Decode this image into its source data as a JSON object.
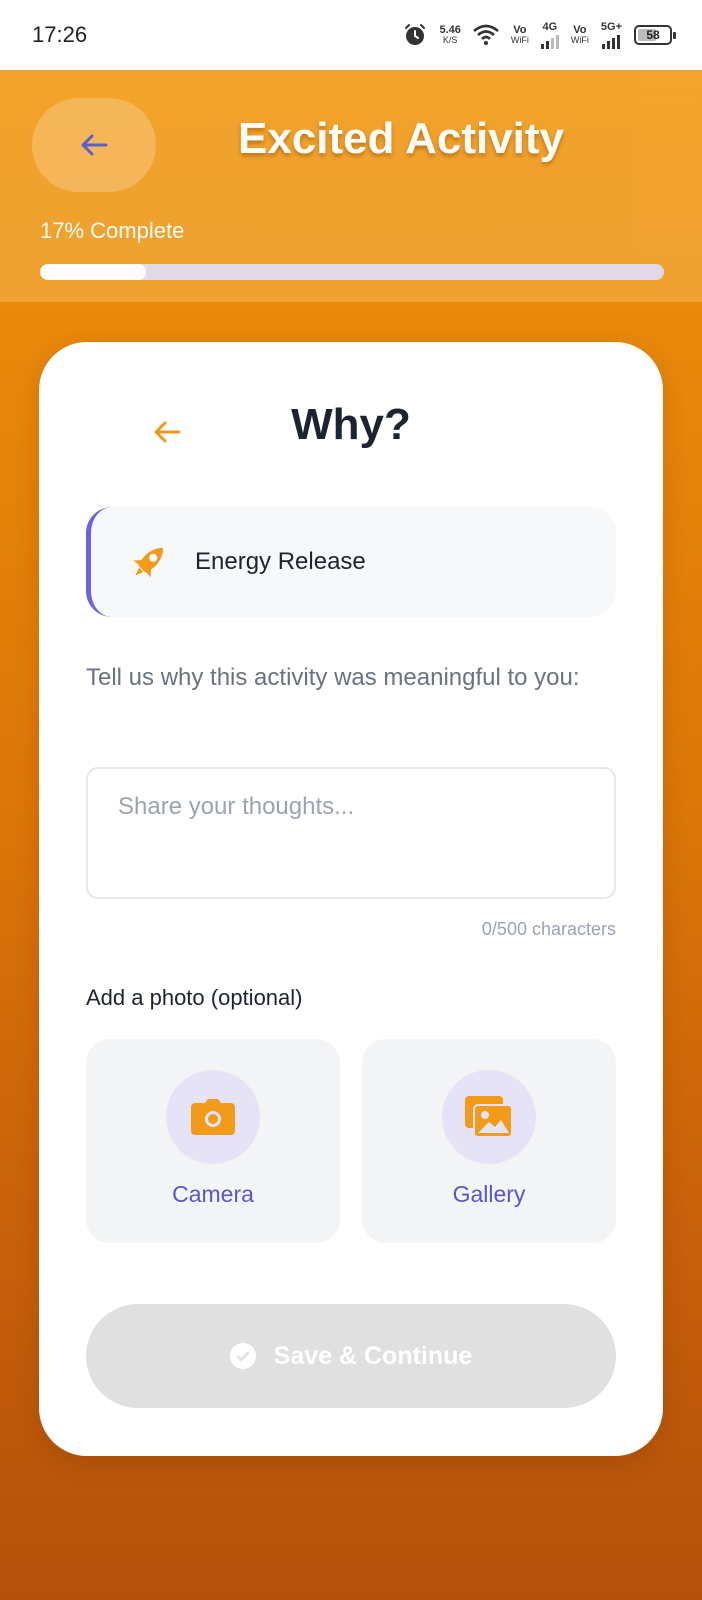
{
  "status_bar": {
    "time": "17:26",
    "net_speed": "5.46",
    "net_unit": "K/S",
    "vo_wifi_1_top": "Vo",
    "vo_wifi_1_bottom": "WiFi",
    "net_4g": "4G",
    "vo_wifi_2_top": "Vo",
    "vo_wifi_2_bottom": "WiFi",
    "net_5g": "5G+",
    "battery": "58"
  },
  "header": {
    "title": "Excited Activity",
    "progress_label": "17% Complete",
    "progress_percent": 17
  },
  "card": {
    "title": "Why?",
    "reason_label": "Energy Release",
    "prompt": "Tell us why this activity was meaningful to you:",
    "input_placeholder": "Share your thoughts...",
    "char_count": "0/500 characters",
    "photo_label": "Add a photo (optional)",
    "camera_label": "Camera",
    "gallery_label": "Gallery",
    "save_label": "Save & Continue"
  },
  "colors": {
    "accent_orange": "#f29a1a",
    "accent_indigo": "#6b63e6",
    "save_disabled": "#e0e0e0"
  },
  "icons": {
    "back": "arrow-left-icon",
    "reason": "rocket-icon",
    "camera": "camera-icon",
    "gallery": "gallery-icon",
    "save": "check-circle-icon"
  }
}
